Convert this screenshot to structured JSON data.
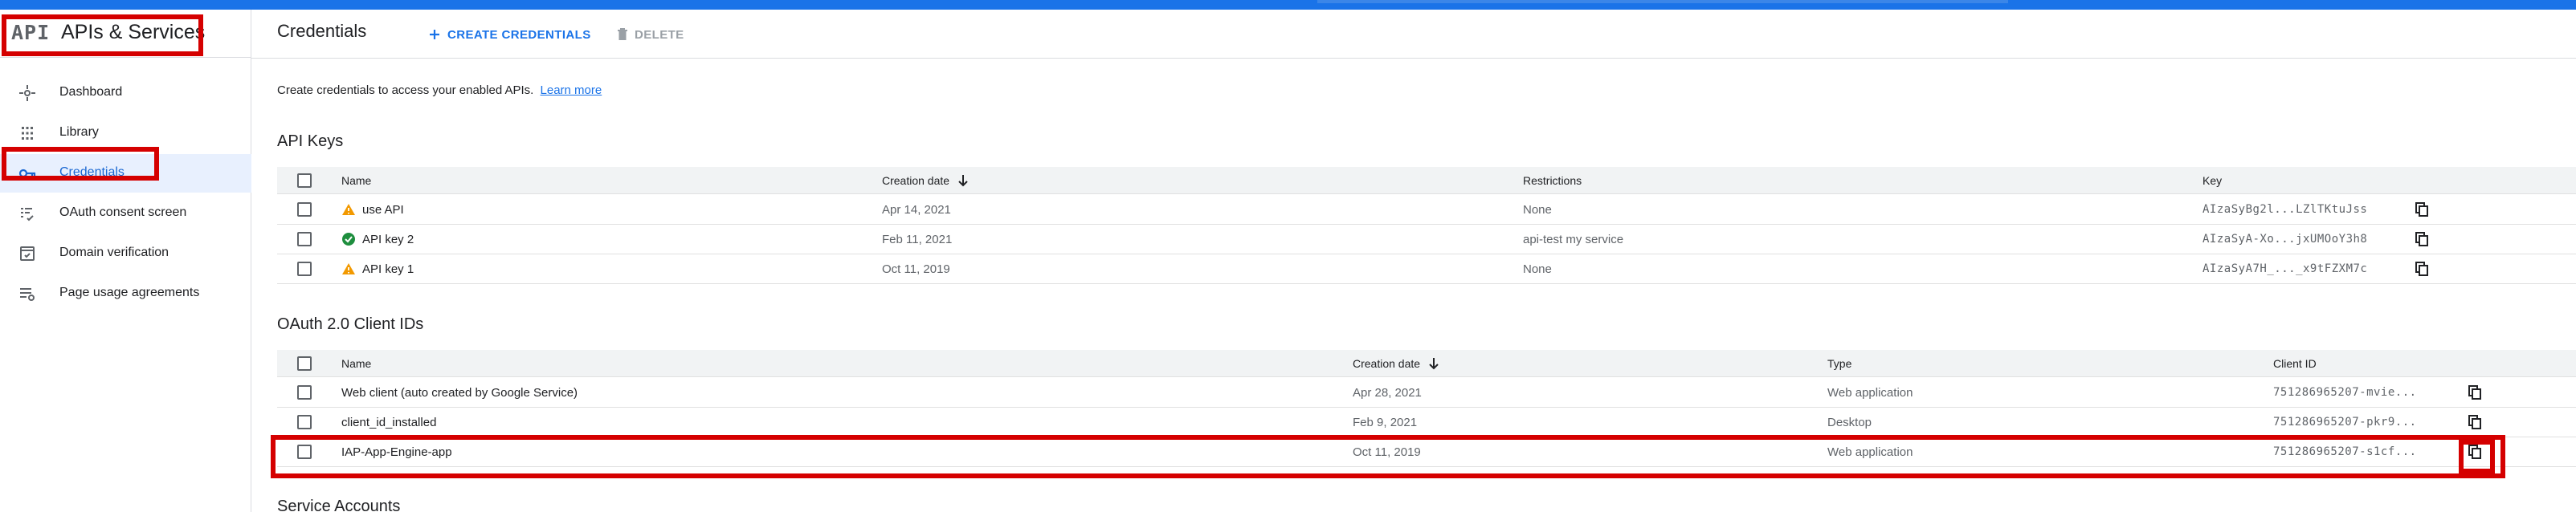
{
  "brand": {
    "logo": "API",
    "title": "APIs & Services"
  },
  "sidebar": {
    "items": [
      {
        "label": "Dashboard",
        "icon": "dashboard-icon"
      },
      {
        "label": "Library",
        "icon": "library-icon"
      },
      {
        "label": "Credentials",
        "icon": "key-icon",
        "active": true
      },
      {
        "label": "OAuth consent screen",
        "icon": "consent-screen-icon"
      },
      {
        "label": "Domain verification",
        "icon": "domain-verification-icon"
      },
      {
        "label": "Page usage agreements",
        "icon": "agreements-icon"
      }
    ]
  },
  "header": {
    "title": "Credentials",
    "create_label": "CREATE CREDENTIALS",
    "delete_label": "DELETE"
  },
  "intro": {
    "text": "Create credentials to access your enabled APIs.",
    "link": "Learn more"
  },
  "api_keys": {
    "title": "API Keys",
    "columns": {
      "name": "Name",
      "created": "Creation date",
      "restrictions": "Restrictions",
      "key": "Key"
    },
    "rows": [
      {
        "status": "warning",
        "name": "use API",
        "created": "Apr 14, 2021",
        "restrictions": "None",
        "key": "AIzaSyBg2l...LZlTKtuJss"
      },
      {
        "status": "ok",
        "name": "API key 2",
        "created": "Feb 11, 2021",
        "restrictions": "api-test my service",
        "key": "AIzaSyA-Xo...jxUMOoY3h8"
      },
      {
        "status": "warning",
        "name": "API key 1",
        "created": "Oct 11, 2019",
        "restrictions": "None",
        "key": "AIzaSyA7H_..._x9tFZXM7c"
      }
    ]
  },
  "oauth": {
    "title": "OAuth 2.0 Client IDs",
    "columns": {
      "name": "Name",
      "created": "Creation date",
      "type": "Type",
      "client_id": "Client ID"
    },
    "rows": [
      {
        "name": "Web client (auto created by Google Service)",
        "created": "Apr 28, 2021",
        "type": "Web application",
        "client_id": "751286965207-mvie..."
      },
      {
        "name": "client_id_installed",
        "created": "Feb 9, 2021",
        "type": "Desktop",
        "client_id": "751286965207-pkr9..."
      },
      {
        "name": "IAP-App-Engine-app",
        "created": "Oct 11, 2019",
        "type": "Web application",
        "client_id": "751286965207-s1cf..."
      }
    ]
  },
  "service_accounts": {
    "title": "Service Accounts"
  },
  "colors": {
    "accent": "#1a73e8",
    "highlight": "#d50000",
    "warning": "#f29900",
    "ok": "#1e8e3e"
  }
}
